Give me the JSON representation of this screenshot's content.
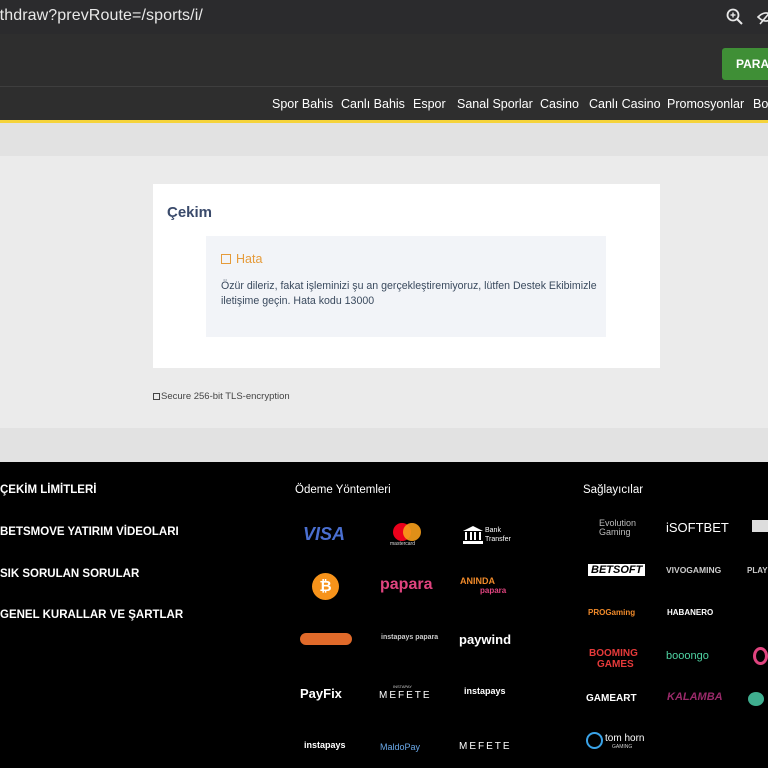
{
  "browser": {
    "url": "ithdraw?prevRoute=/sports/i/",
    "icons": [
      "zoom-icon",
      "hide-eye-icon"
    ]
  },
  "header": {
    "deposit_label": "PARA Y",
    "nav": [
      "Spor Bahis",
      "Canlı Bahis",
      "Espor",
      "Sanal Sporlar",
      "Casino",
      "Canlı Casino",
      "Promosyonlar",
      "Bo"
    ]
  },
  "withdraw": {
    "title": "Çekim",
    "error_title": "Hata",
    "error_message": "Özür dileriz, fakat işleminizi şu an gerçekleştiremiyoruz, lütfen Destek Ekibimizle iletişime geçin. Hata kodu 13000",
    "tls": "Secure 256-bit TLS-encryption"
  },
  "footer": {
    "links": [
      "ÇEKİM LİMİTLERİ",
      "BETSMOVE YATIRIM VİDEOLARI",
      "SIK SORULAN SORULAR",
      "GENEL KURALLAR VE ŞARTLAR"
    ],
    "payments_title": "Ödeme Yöntemleri",
    "providers_title": "Sağlayıcılar",
    "payments": {
      "visa": "VISA",
      "mastercard": "mastercard",
      "bank_1": "Bank",
      "bank_2": "Transfer",
      "papara": "papara",
      "aninda_1": "ANINDA",
      "aninda_2": "papara",
      "paywind": "paywind",
      "instapays_papara": "instapays papara",
      "payfix": "PayFix",
      "mefete_top": "INSTAPAY",
      "mefete": "MEFETE",
      "instapays_havale": "instapays",
      "instapays_vip": "instapays",
      "maldopay": "MaldoPay",
      "mefete_2": "MEFETE"
    },
    "providers": {
      "evolution_1": "Evolution",
      "evolution_2": "Gaming",
      "isoftbet": "iSOFTBET",
      "betsoft": "BETSOFT",
      "vivo": "VIVOGAMING",
      "play": "PLAY",
      "progaming": "PROGaming",
      "habanero": "HABANERO",
      "booming_1": "BOOMING",
      "booming_2": "GAMES",
      "booongo": "booongo",
      "gameart": "GAMEART",
      "kalamba": "KALAMBA",
      "tomhorn_1": "tom horn",
      "tomhorn_2": "GAMING"
    }
  }
}
